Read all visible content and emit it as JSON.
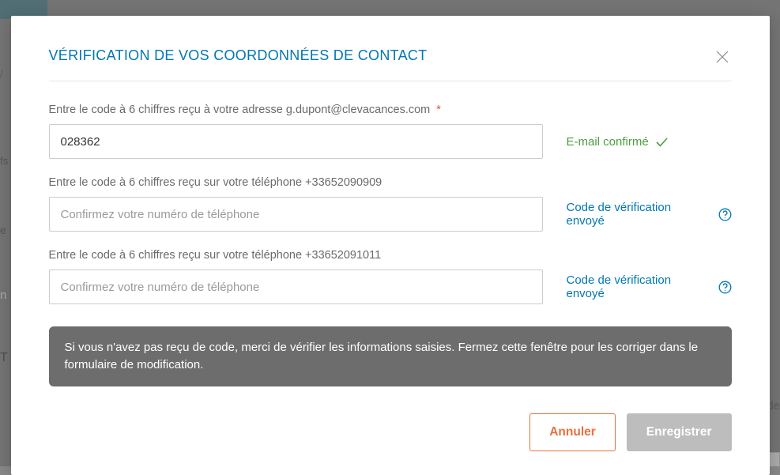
{
  "modal": {
    "title": "VÉRIFICATION DE VOS COORDONNÉES DE CONTACT",
    "fields": [
      {
        "label": "Entre le code à 6 chiffres reçu à votre adresse g.dupont@clevacances.com",
        "required": true,
        "value": "028362",
        "placeholder": "",
        "status_text": "E-mail confirmé",
        "status_type": "confirmed"
      },
      {
        "label": "Entre le code à 6 chiffres reçu sur votre téléphone +33652090909",
        "required": false,
        "value": "",
        "placeholder": "Confirmez votre numéro de téléphone",
        "status_text": "Code de vérification envoyé",
        "status_type": "sent"
      },
      {
        "label": "Entre le code à 6 chiffres reçu sur votre téléphone +33652091011",
        "required": false,
        "value": "",
        "placeholder": "Confirmez votre numéro de téléphone",
        "status_text": "Code de vérification envoyé",
        "status_type": "sent"
      }
    ],
    "info_banner": "Si vous n'avez pas reçu de code, merci de vérifier les informations saisies. Fermez cette fenêtre pour les corriger dans le formulaire de modification.",
    "buttons": {
      "cancel": "Annuler",
      "save": "Enregistrer"
    },
    "required_mark": "*"
  },
  "background": {
    "t1": "/",
    "t2": "fs",
    "t3": "e",
    "t4": "n",
    "t5": "T",
    "t6": "de"
  }
}
